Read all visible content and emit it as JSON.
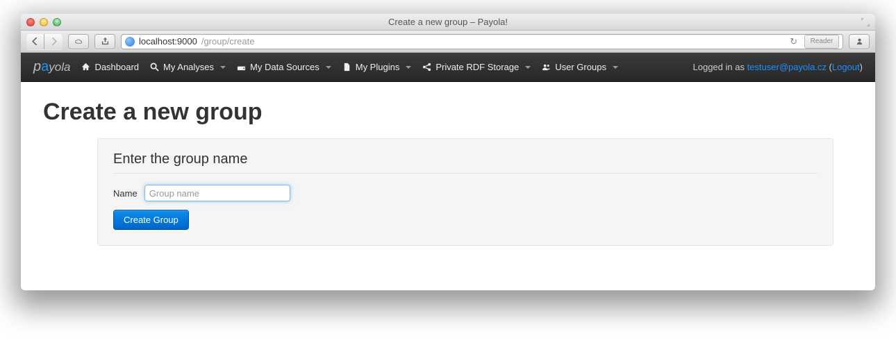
{
  "window": {
    "title": "Create a new group – Payola!"
  },
  "toolbar": {
    "url_host": "localhost:9000",
    "url_path": "/group/create",
    "reader_label": "Reader"
  },
  "navbar": {
    "brand_p": "p",
    "brand_a": "a",
    "brand_yola": "yola",
    "items": [
      {
        "label": "Dashboard",
        "dropdown": false
      },
      {
        "label": "My Analyses",
        "dropdown": true
      },
      {
        "label": "My Data Sources",
        "dropdown": true
      },
      {
        "label": "My Plugins",
        "dropdown": true
      },
      {
        "label": "Private RDF Storage",
        "dropdown": true
      },
      {
        "label": "User Groups",
        "dropdown": true
      }
    ],
    "logged_in_as": "Logged in as ",
    "user_email": "testuser@payola.cz",
    "logout_open": " (",
    "logout_label": "Logout",
    "logout_close": ")"
  },
  "page": {
    "heading": "Create a new group",
    "legend": "Enter the group name",
    "name_label": "Name",
    "name_placeholder": "Group name",
    "submit_label": "Create Group"
  }
}
